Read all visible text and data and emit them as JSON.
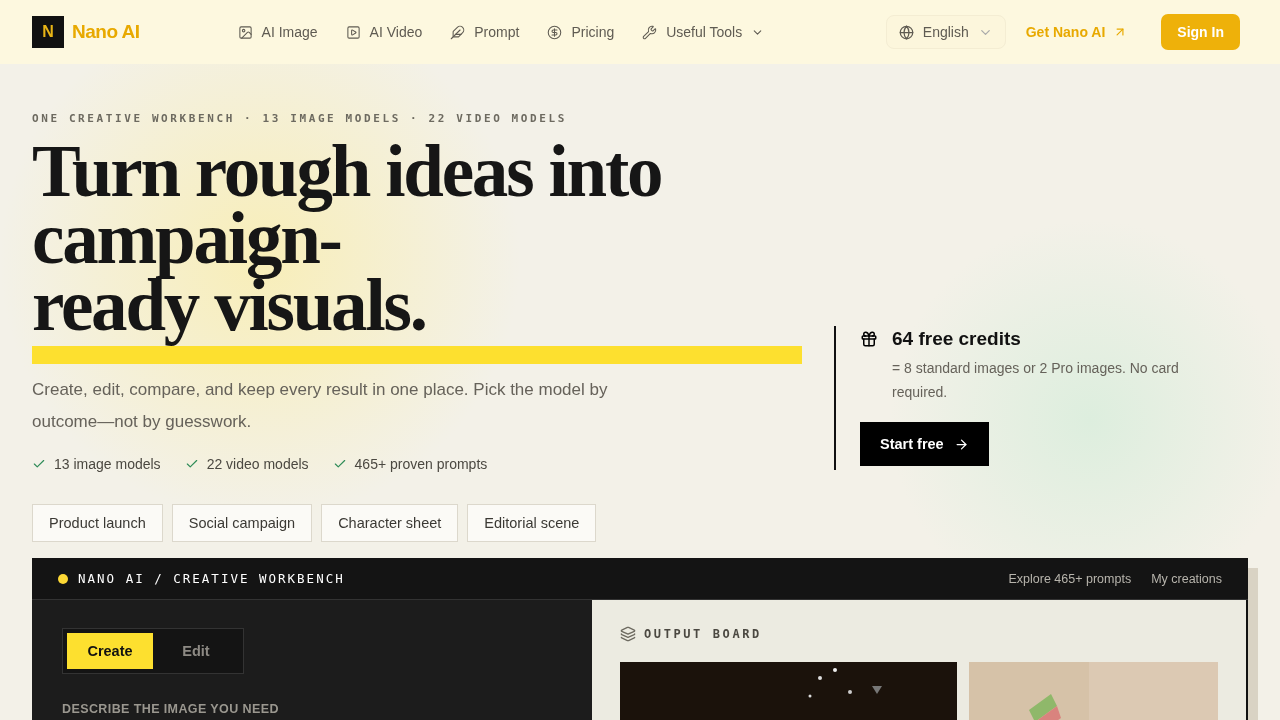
{
  "header": {
    "brand": "Nano AI",
    "brand_mark": "N",
    "nav": [
      {
        "label": "AI Image",
        "dropdown": false
      },
      {
        "label": "AI Video",
        "dropdown": false
      },
      {
        "label": "Prompt",
        "dropdown": false
      },
      {
        "label": "Pricing",
        "dropdown": false
      },
      {
        "label": "Useful Tools",
        "dropdown": true
      }
    ],
    "language": "English",
    "get_link": "Get Nano AI",
    "sign_in": "Sign In"
  },
  "hero": {
    "eyebrow": "ONE CREATIVE WORKBENCH · 13 IMAGE MODELS · 22 VIDEO MODELS",
    "headline_lines": [
      "Turn rough ideas into",
      "campaign-",
      "ready visuals."
    ],
    "subtitle": "Create, edit, compare, and keep every result in one place. Pick the model by outcome—not by guesswork.",
    "checks": [
      "13 image models",
      "22 video models",
      "465+ proven prompts"
    ],
    "chips": [
      "Product launch",
      "Social campaign",
      "Character sheet",
      "Editorial scene"
    ],
    "credits": {
      "title": "64 free credits",
      "note": "= 8 standard images or 2 Pro images. No card required.",
      "button": "Start free"
    }
  },
  "workbench": {
    "title": "NANO AI / CREATIVE WORKBENCH",
    "links": [
      "Explore 465+ prompts",
      "My creations"
    ],
    "tabs": [
      {
        "label": "Create",
        "selected": true
      },
      {
        "label": "Edit",
        "selected": false
      }
    ],
    "prompt_label": "DESCRIBE THE IMAGE YOU NEED",
    "output_title": "OUTPUT BOARD",
    "outputs": [
      {
        "kind": "picture"
      },
      {
        "kind": "picture"
      }
    ]
  }
}
